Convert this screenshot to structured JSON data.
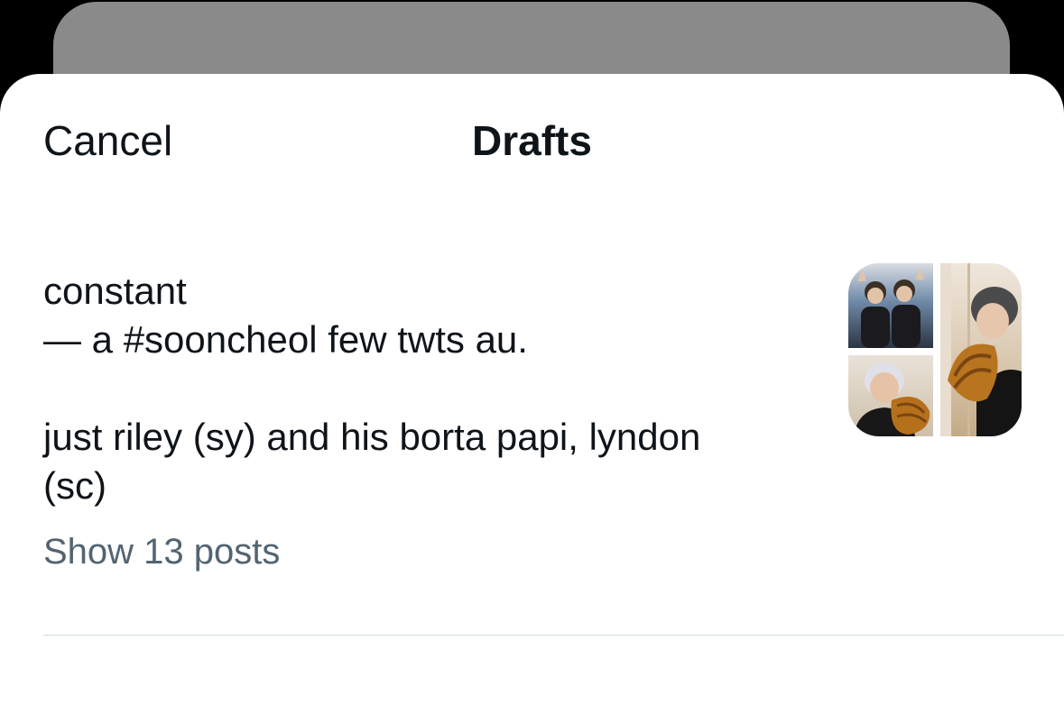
{
  "header": {
    "cancel_label": "Cancel",
    "title": "Drafts"
  },
  "draft": {
    "text": "constant\n— a #sooncheol few twts au.\n\njust riley (sy) and his borta papi, lyndon\n(sc)",
    "show_posts_label": "Show 13 posts",
    "media_count": 3
  },
  "colors": {
    "text": "#0f1419",
    "secondary": "#536471",
    "divider": "#cfd9de",
    "backdrop_card": "#8a8a8a"
  }
}
